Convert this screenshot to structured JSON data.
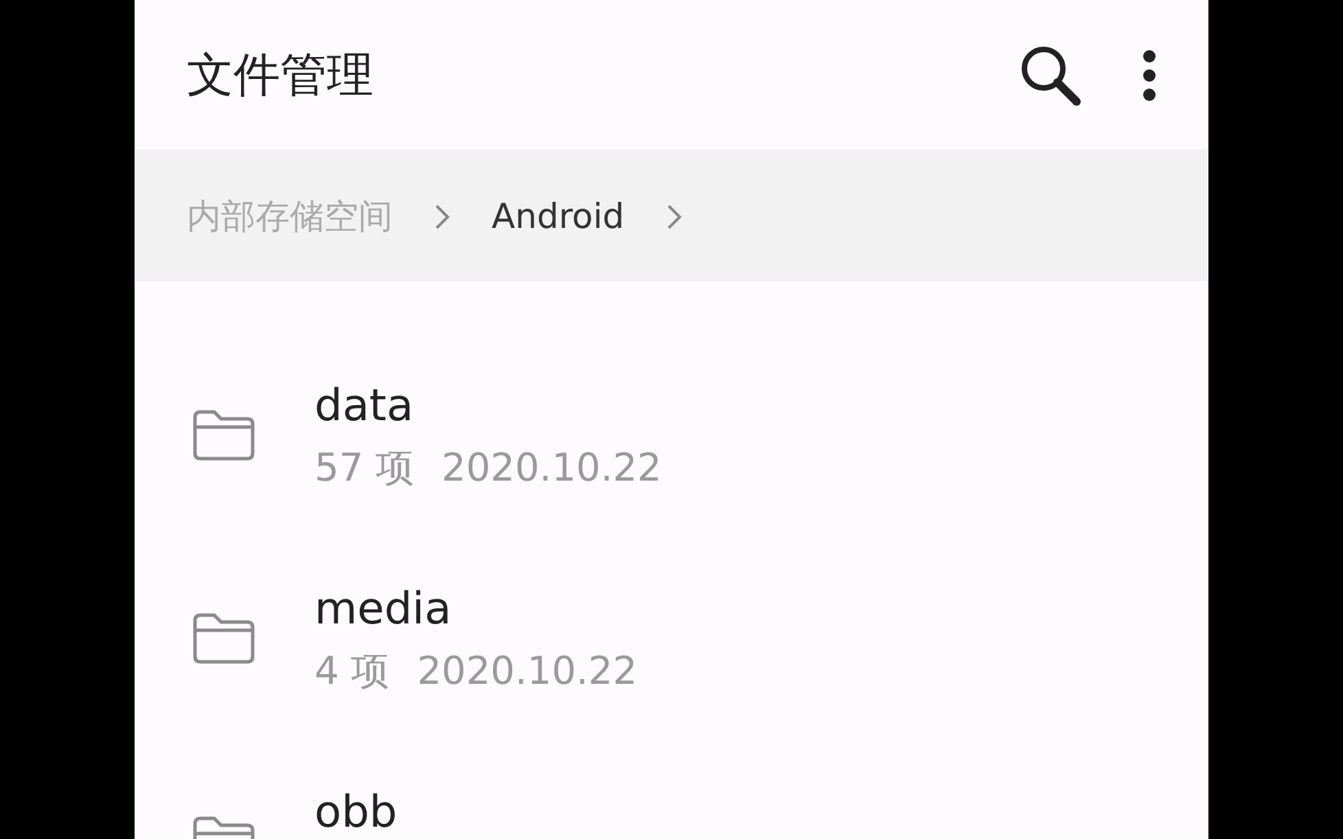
{
  "app_bar": {
    "title": "文件管理"
  },
  "breadcrumb": [
    {
      "label": "内部存储空间",
      "selected": false
    },
    {
      "label": "Android",
      "selected": true
    }
  ],
  "files": [
    {
      "name": "data",
      "meta": [
        {
          "text": "57 项"
        },
        {
          "text": "2020.10.22"
        }
      ]
    },
    {
      "name": "media",
      "meta": [
        {
          "text": "4 项"
        },
        {
          "text": "2020.10.22"
        }
      ]
    },
    {
      "name": "obb"
    }
  ]
}
